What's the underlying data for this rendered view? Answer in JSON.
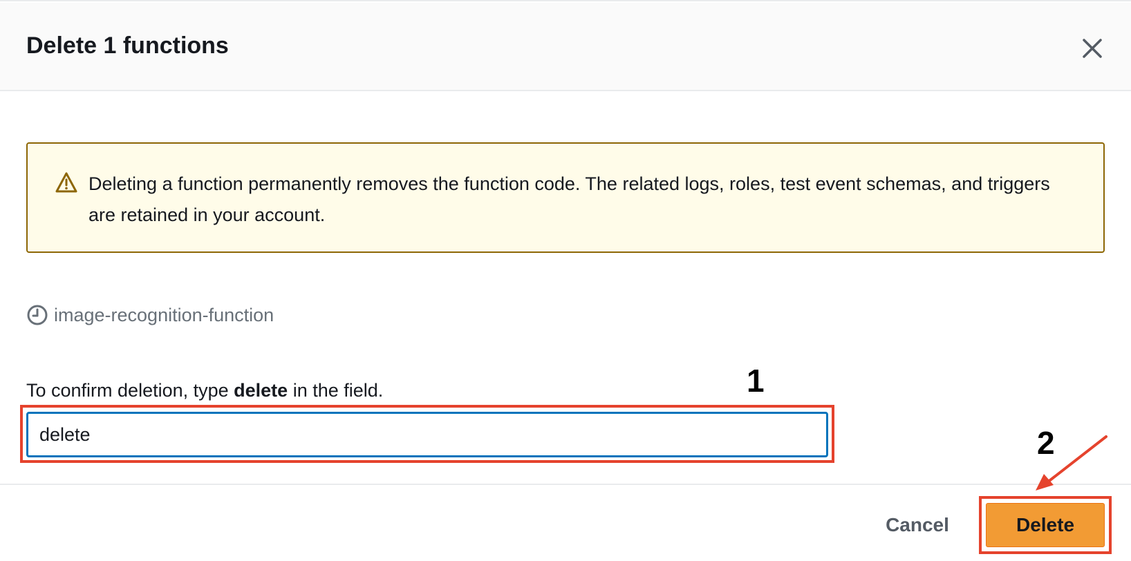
{
  "modal": {
    "title": "Delete 1 functions"
  },
  "alert": {
    "message": "Deleting a function permanently removes the function code. The related logs, roles, test event schemas, and triggers are retained in your account."
  },
  "resource": {
    "name": "image-recognition-function"
  },
  "confirm": {
    "label_prefix": "To confirm deletion, type ",
    "keyword": "delete",
    "label_suffix": " in the field.",
    "input_value": "delete"
  },
  "annotations": {
    "step1": "1",
    "step2": "2"
  },
  "footer": {
    "cancel_label": "Cancel",
    "delete_label": "Delete"
  },
  "colors": {
    "primary_button": "#f29b34",
    "annotation_red": "#e5432d",
    "warning_border": "#8d6605",
    "warning_bg": "#fffce9",
    "focus_border": "#0073bb"
  },
  "icons": {
    "close": "close-icon",
    "warning": "warning-icon",
    "resource": "clock-icon"
  }
}
